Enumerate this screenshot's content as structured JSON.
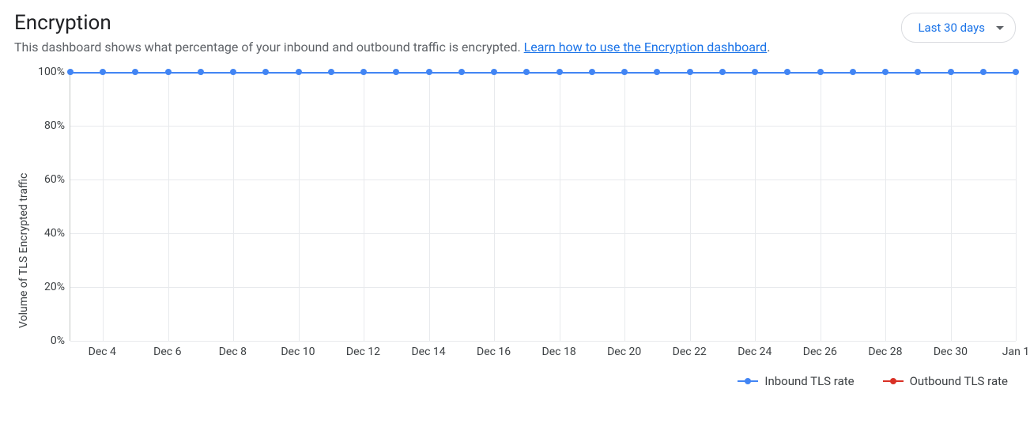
{
  "header": {
    "title": "Encryption",
    "subtitle_prefix": "This dashboard shows what percentage of your inbound and outbound traffic is encrypted. ",
    "subtitle_link": "Learn how to use the Encryption dashboard",
    "subtitle_suffix": "."
  },
  "range_selector": {
    "label": "Last 30 days"
  },
  "chart_data": {
    "type": "line",
    "title": "",
    "xlabel": "",
    "ylabel": "Volume of TLS Encrypted traffic",
    "ylim": [
      0,
      100
    ],
    "y_tick_labels": [
      "0%",
      "20%",
      "40%",
      "60%",
      "80%",
      "100%"
    ],
    "y_tick_values": [
      0,
      20,
      40,
      60,
      80,
      100
    ],
    "categories": [
      "Dec 3",
      "Dec 4",
      "Dec 5",
      "Dec 6",
      "Dec 7",
      "Dec 8",
      "Dec 9",
      "Dec 10",
      "Dec 11",
      "Dec 12",
      "Dec 13",
      "Dec 14",
      "Dec 15",
      "Dec 16",
      "Dec 17",
      "Dec 18",
      "Dec 19",
      "Dec 20",
      "Dec 21",
      "Dec 22",
      "Dec 23",
      "Dec 24",
      "Dec 25",
      "Dec 26",
      "Dec 27",
      "Dec 28",
      "Dec 29",
      "Dec 30",
      "Dec 31",
      "Jan 1"
    ],
    "x_tick_labels": [
      "Dec 4",
      "Dec 6",
      "Dec 8",
      "Dec 10",
      "Dec 12",
      "Dec 14",
      "Dec 16",
      "Dec 18",
      "Dec 20",
      "Dec 22",
      "Dec 24",
      "Dec 26",
      "Dec 28",
      "Dec 30",
      "Jan 1"
    ],
    "x_tick_indices": [
      1,
      3,
      5,
      7,
      9,
      11,
      13,
      15,
      17,
      19,
      21,
      23,
      25,
      27,
      29
    ],
    "series": [
      {
        "name": "Inbound TLS rate",
        "color": "#4285f4",
        "values": [
          100,
          100,
          100,
          100,
          100,
          100,
          100,
          100,
          100,
          100,
          100,
          100,
          100,
          100,
          100,
          100,
          100,
          100,
          100,
          100,
          100,
          100,
          100,
          100,
          100,
          100,
          100,
          100,
          100,
          100
        ]
      },
      {
        "name": "Outbound TLS rate",
        "color": "#d93025",
        "values": []
      }
    ],
    "legend_position": "bottom-right",
    "grid": true
  }
}
